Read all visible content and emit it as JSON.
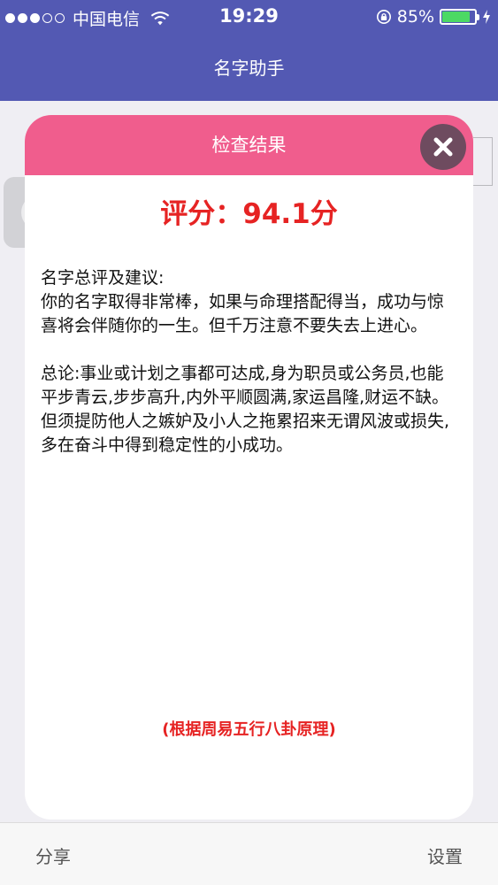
{
  "status_bar": {
    "carrier": "中国电信",
    "time": "19:29",
    "battery_percent": "85%",
    "battery_level": 0.85,
    "signal_bars_filled": 3,
    "signal_bars_total": 5
  },
  "nav": {
    "title": "名字助手"
  },
  "modal": {
    "header_title": "检查结果",
    "score": "评分：94.1分",
    "advice_heading": "名字总评及建议:",
    "advice_text": "你的名字取得非常棒，如果与命理搭配得当，成功与惊喜将会伴随你的一生。但千万注意不要失去上进心。",
    "summary_text": "总论:事业或计划之事都可达成,身为职员或公务员,也能平步青云,步步高升,内外平顺圆满,家运昌隆,财运不缺。但须提防他人之嫉妒及小人之拖累招来无谓风波或损失,多在奋斗中得到稳定性的小成功。",
    "footer_note": "(根据周易五行八卦原理)"
  },
  "tab_bar": {
    "share_label": "分享",
    "settings_label": "设置"
  },
  "colors": {
    "nav_bg": "#5359b3",
    "modal_header_bg": "#f05d8d",
    "accent_red": "#e62323",
    "close_button_bg": "#6e4b5f",
    "battery_green": "#4cd964"
  }
}
